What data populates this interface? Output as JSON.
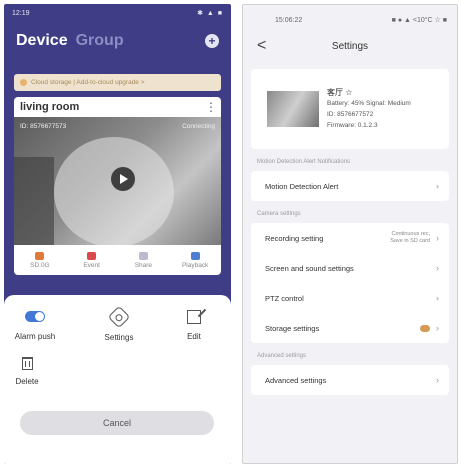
{
  "left": {
    "status_bar": {
      "time": "12:19",
      "right": "✱ ▲ ■"
    },
    "tabs": {
      "device": "Device",
      "group": "Group"
    },
    "banner_text": "Cloud storage | Add-to-cloud upgrade >",
    "room_name": "living room",
    "camera": {
      "device_id": "ID: 8576677573",
      "status": "Connecting"
    },
    "actions": [
      {
        "label": "SD.0G"
      },
      {
        "label": "Event"
      },
      {
        "label": "Share"
      },
      {
        "label": "Playback"
      }
    ],
    "sheet": {
      "options": [
        {
          "label": "Alarm push"
        },
        {
          "label": "Settings"
        },
        {
          "label": "Edit"
        },
        {
          "label": "Delete"
        }
      ],
      "cancel": "Cancel"
    }
  },
  "right": {
    "status_bar": {
      "time": "15:06:22",
      "right": "■ ● ▲ <10°C ☆ ■"
    },
    "nav": {
      "back": "<",
      "title": "Settings"
    },
    "device": {
      "name": "客厅 ☆",
      "line1": "Battery: 45% Signal: Medium",
      "line2": "ID: 8576677572",
      "line3": "Firmware: 0.1.2.3"
    },
    "sections": [
      {
        "label": "Motion Detection Alert Notifications",
        "rows": [
          {
            "label": "Motion Detection Alert"
          }
        ]
      },
      {
        "label": "Camera settings",
        "rows": [
          {
            "label": "Recording setting",
            "sub": "Continuous rec, Save in SD card"
          },
          {
            "label": "Screen and sound settings"
          },
          {
            "label": "PTZ control"
          },
          {
            "label": "Storage settings",
            "icon": "cloud-icon"
          }
        ]
      },
      {
        "label": "Advanced settings",
        "rows": [
          {
            "label": "Advanced settings"
          }
        ]
      }
    ]
  }
}
